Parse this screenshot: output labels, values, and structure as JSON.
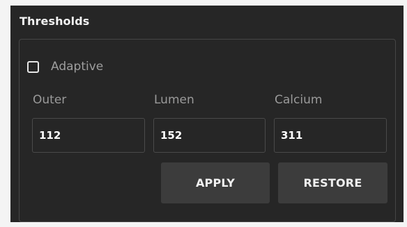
{
  "panel": {
    "title": "Thresholds"
  },
  "adaptive": {
    "label": "Adaptive",
    "checked": false
  },
  "fields": [
    {
      "label": "Outer",
      "value": "112"
    },
    {
      "label": "Lumen",
      "value": "152"
    },
    {
      "label": "Calcium",
      "value": "311"
    }
  ],
  "buttons": {
    "apply": "APPLY",
    "restore": "RESTORE"
  },
  "colors": {
    "panel_background": "#262626",
    "page_background": "#f4f4f4",
    "button_background": "#3c3c3c",
    "muted_text": "#9e9e9e"
  }
}
